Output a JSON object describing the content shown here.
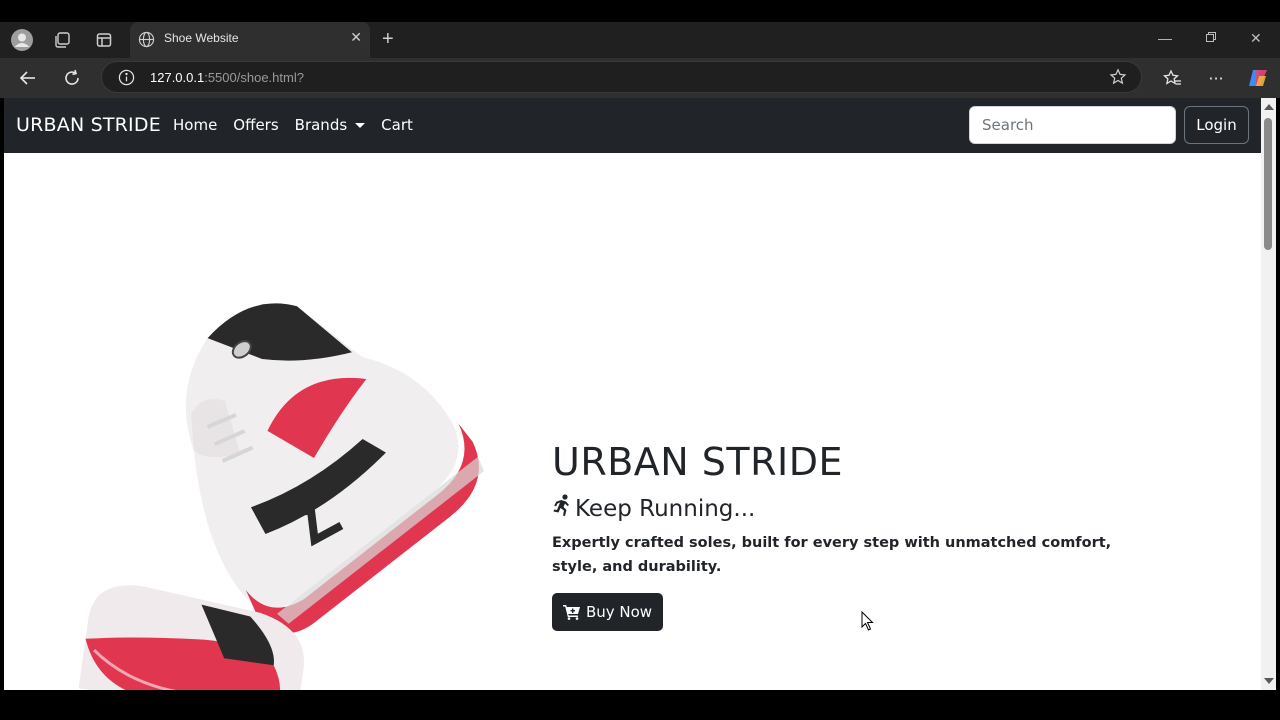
{
  "browser": {
    "tab_title": "Shoe Website",
    "url_host": "127.0.0.1",
    "url_rest": ":5500/shoe.html?"
  },
  "site": {
    "brand": "URBAN STRIDE",
    "nav": {
      "home": "Home",
      "offers": "Offers",
      "brands": "Brands",
      "cart": "Cart"
    },
    "search_placeholder": "Search",
    "login_label": "Login"
  },
  "hero": {
    "title": "URBAN STRIDE",
    "subtitle": "Keep Running...",
    "description": "Expertly crafted soles, built for every step with unmatched comfort, style, and durability.",
    "buy_label": "Buy Now",
    "accent_color": "#212529",
    "shoe_colors": [
      "#e0364f",
      "#f2f2f2",
      "#2a2a2a"
    ]
  },
  "icons": {
    "profile": "profile-icon",
    "workspaces": "workspaces-icon",
    "tab_actions": "tab-actions-icon",
    "favicon": "globe-icon",
    "close": "close-icon",
    "new_tab": "plus-icon",
    "back": "back-arrow-icon",
    "reload": "reload-icon",
    "site_info": "info-icon",
    "favorite": "star-icon",
    "favorites": "favorites-icon",
    "more": "more-icon",
    "copilot": "copilot-icon",
    "runner": "running-person-icon",
    "cart": "shopping-cart-icon"
  }
}
